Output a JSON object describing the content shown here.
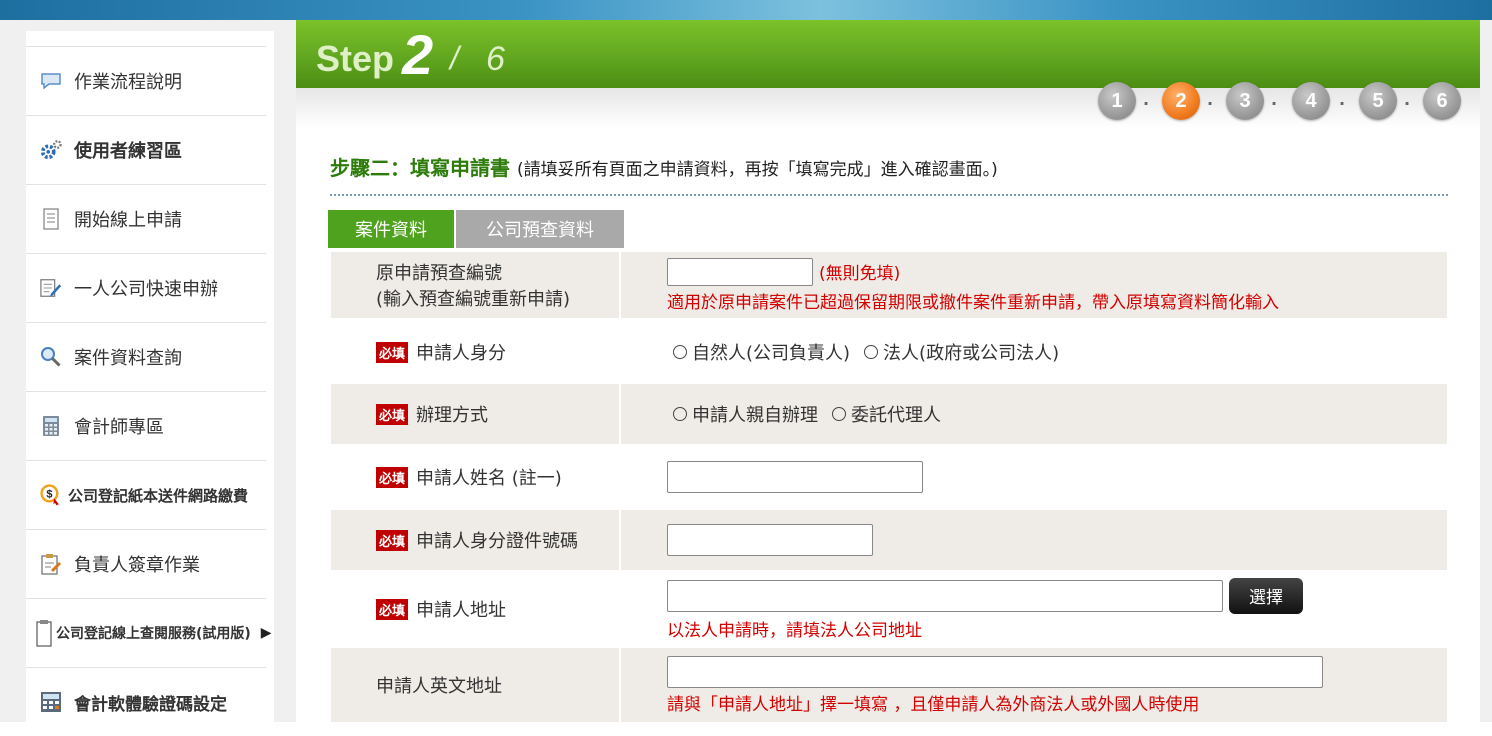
{
  "sidebar": {
    "items": [
      {
        "label": "作業流程說明",
        "icon": "chat-bubble-icon"
      },
      {
        "label": "使用者練習區",
        "icon": "gears-icon"
      },
      {
        "label": "開始線上申請",
        "icon": "document-icon"
      },
      {
        "label": "一人公司快速申辦",
        "icon": "edit-document-icon"
      },
      {
        "label": "案件資料查詢",
        "icon": "magnifier-icon"
      },
      {
        "label": "會計師專區",
        "icon": "calculator-icon"
      },
      {
        "label": "公司登記紙本送件網路繳費",
        "icon": "dollar-icon"
      },
      {
        "label": "負責人簽章作業",
        "icon": "clipboard-sign-icon"
      },
      {
        "label": "公司登記線上查閱服務(試用版)",
        "icon": "clipboard-icon"
      },
      {
        "label": "會計軟體驗證碼設定",
        "icon": "keypad-icon"
      }
    ]
  },
  "step": {
    "word": "Step",
    "current": "2",
    "slash": "/",
    "total": "6",
    "indicators": [
      "1",
      "2",
      "3",
      "4",
      "5",
      "6"
    ],
    "active_index": 1
  },
  "page": {
    "title": "步驟二：填寫申請書",
    "hint": "(請填妥所有頁面之申請資料，再按「填寫完成」進入確認畫面。)"
  },
  "tabs": [
    {
      "label": "案件資料",
      "active": true
    },
    {
      "label": "公司預查資料",
      "active": false
    }
  ],
  "required_badge": "必填",
  "form": {
    "orig_no": {
      "label1": "原申請預查編號",
      "label2": "(輸入預查編號重新申請)",
      "value": "",
      "note": "(無則免填)",
      "help": "適用於原申請案件已超過保留期限或撤件案件重新申請，帶入原填寫資料簡化輸入"
    },
    "applicant_type": {
      "label": "申請人身分",
      "options": [
        "自然人(公司負責人)",
        "法人(政府或公司法人)"
      ]
    },
    "handling": {
      "label": "辦理方式",
      "options": [
        "申請人親自辦理",
        "委託代理人"
      ]
    },
    "name": {
      "label": "申請人姓名 (註一)",
      "value": ""
    },
    "id_no": {
      "label": "申請人身分證件號碼",
      "value": ""
    },
    "address": {
      "label": "申請人地址",
      "value": "",
      "button": "選擇",
      "help": "以法人申請時，請填法人公司地址"
    },
    "en_address": {
      "label": "申請人英文地址",
      "value": "",
      "help": "請與「申請人地址」擇一填寫 ，且僅申請人為外商法人或外國人時使用"
    }
  },
  "colors": {
    "green": "#4fa21e",
    "title_green": "#2d7c0b",
    "required_red": "#c00000",
    "orange": "#f07a1e"
  }
}
